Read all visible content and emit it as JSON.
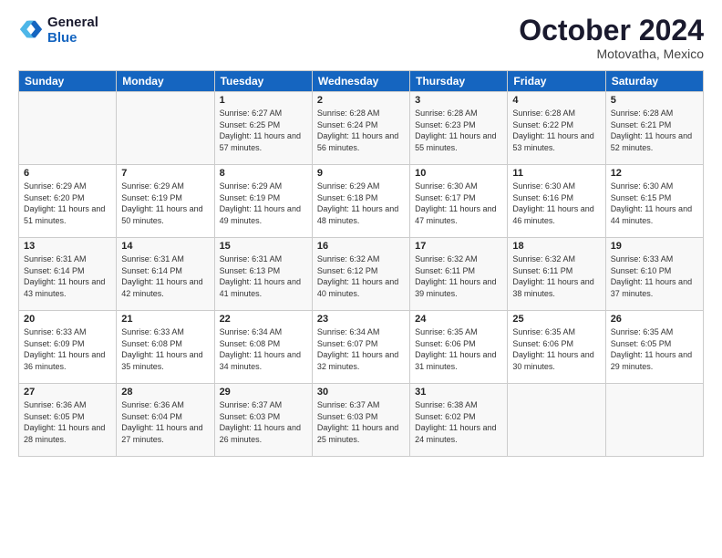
{
  "header": {
    "logo_line1": "General",
    "logo_line2": "Blue",
    "month": "October 2024",
    "location": "Motovatha, Mexico"
  },
  "days_of_week": [
    "Sunday",
    "Monday",
    "Tuesday",
    "Wednesday",
    "Thursday",
    "Friday",
    "Saturday"
  ],
  "weeks": [
    [
      {
        "day": "",
        "info": ""
      },
      {
        "day": "",
        "info": ""
      },
      {
        "day": "1",
        "info": "Sunrise: 6:27 AM\nSunset: 6:25 PM\nDaylight: 11 hours and 57 minutes."
      },
      {
        "day": "2",
        "info": "Sunrise: 6:28 AM\nSunset: 6:24 PM\nDaylight: 11 hours and 56 minutes."
      },
      {
        "day": "3",
        "info": "Sunrise: 6:28 AM\nSunset: 6:23 PM\nDaylight: 11 hours and 55 minutes."
      },
      {
        "day": "4",
        "info": "Sunrise: 6:28 AM\nSunset: 6:22 PM\nDaylight: 11 hours and 53 minutes."
      },
      {
        "day": "5",
        "info": "Sunrise: 6:28 AM\nSunset: 6:21 PM\nDaylight: 11 hours and 52 minutes."
      }
    ],
    [
      {
        "day": "6",
        "info": "Sunrise: 6:29 AM\nSunset: 6:20 PM\nDaylight: 11 hours and 51 minutes."
      },
      {
        "day": "7",
        "info": "Sunrise: 6:29 AM\nSunset: 6:19 PM\nDaylight: 11 hours and 50 minutes."
      },
      {
        "day": "8",
        "info": "Sunrise: 6:29 AM\nSunset: 6:19 PM\nDaylight: 11 hours and 49 minutes."
      },
      {
        "day": "9",
        "info": "Sunrise: 6:29 AM\nSunset: 6:18 PM\nDaylight: 11 hours and 48 minutes."
      },
      {
        "day": "10",
        "info": "Sunrise: 6:30 AM\nSunset: 6:17 PM\nDaylight: 11 hours and 47 minutes."
      },
      {
        "day": "11",
        "info": "Sunrise: 6:30 AM\nSunset: 6:16 PM\nDaylight: 11 hours and 46 minutes."
      },
      {
        "day": "12",
        "info": "Sunrise: 6:30 AM\nSunset: 6:15 PM\nDaylight: 11 hours and 44 minutes."
      }
    ],
    [
      {
        "day": "13",
        "info": "Sunrise: 6:31 AM\nSunset: 6:14 PM\nDaylight: 11 hours and 43 minutes."
      },
      {
        "day": "14",
        "info": "Sunrise: 6:31 AM\nSunset: 6:14 PM\nDaylight: 11 hours and 42 minutes."
      },
      {
        "day": "15",
        "info": "Sunrise: 6:31 AM\nSunset: 6:13 PM\nDaylight: 11 hours and 41 minutes."
      },
      {
        "day": "16",
        "info": "Sunrise: 6:32 AM\nSunset: 6:12 PM\nDaylight: 11 hours and 40 minutes."
      },
      {
        "day": "17",
        "info": "Sunrise: 6:32 AM\nSunset: 6:11 PM\nDaylight: 11 hours and 39 minutes."
      },
      {
        "day": "18",
        "info": "Sunrise: 6:32 AM\nSunset: 6:11 PM\nDaylight: 11 hours and 38 minutes."
      },
      {
        "day": "19",
        "info": "Sunrise: 6:33 AM\nSunset: 6:10 PM\nDaylight: 11 hours and 37 minutes."
      }
    ],
    [
      {
        "day": "20",
        "info": "Sunrise: 6:33 AM\nSunset: 6:09 PM\nDaylight: 11 hours and 36 minutes."
      },
      {
        "day": "21",
        "info": "Sunrise: 6:33 AM\nSunset: 6:08 PM\nDaylight: 11 hours and 35 minutes."
      },
      {
        "day": "22",
        "info": "Sunrise: 6:34 AM\nSunset: 6:08 PM\nDaylight: 11 hours and 34 minutes."
      },
      {
        "day": "23",
        "info": "Sunrise: 6:34 AM\nSunset: 6:07 PM\nDaylight: 11 hours and 32 minutes."
      },
      {
        "day": "24",
        "info": "Sunrise: 6:35 AM\nSunset: 6:06 PM\nDaylight: 11 hours and 31 minutes."
      },
      {
        "day": "25",
        "info": "Sunrise: 6:35 AM\nSunset: 6:06 PM\nDaylight: 11 hours and 30 minutes."
      },
      {
        "day": "26",
        "info": "Sunrise: 6:35 AM\nSunset: 6:05 PM\nDaylight: 11 hours and 29 minutes."
      }
    ],
    [
      {
        "day": "27",
        "info": "Sunrise: 6:36 AM\nSunset: 6:05 PM\nDaylight: 11 hours and 28 minutes."
      },
      {
        "day": "28",
        "info": "Sunrise: 6:36 AM\nSunset: 6:04 PM\nDaylight: 11 hours and 27 minutes."
      },
      {
        "day": "29",
        "info": "Sunrise: 6:37 AM\nSunset: 6:03 PM\nDaylight: 11 hours and 26 minutes."
      },
      {
        "day": "30",
        "info": "Sunrise: 6:37 AM\nSunset: 6:03 PM\nDaylight: 11 hours and 25 minutes."
      },
      {
        "day": "31",
        "info": "Sunrise: 6:38 AM\nSunset: 6:02 PM\nDaylight: 11 hours and 24 minutes."
      },
      {
        "day": "",
        "info": ""
      },
      {
        "day": "",
        "info": ""
      }
    ]
  ]
}
